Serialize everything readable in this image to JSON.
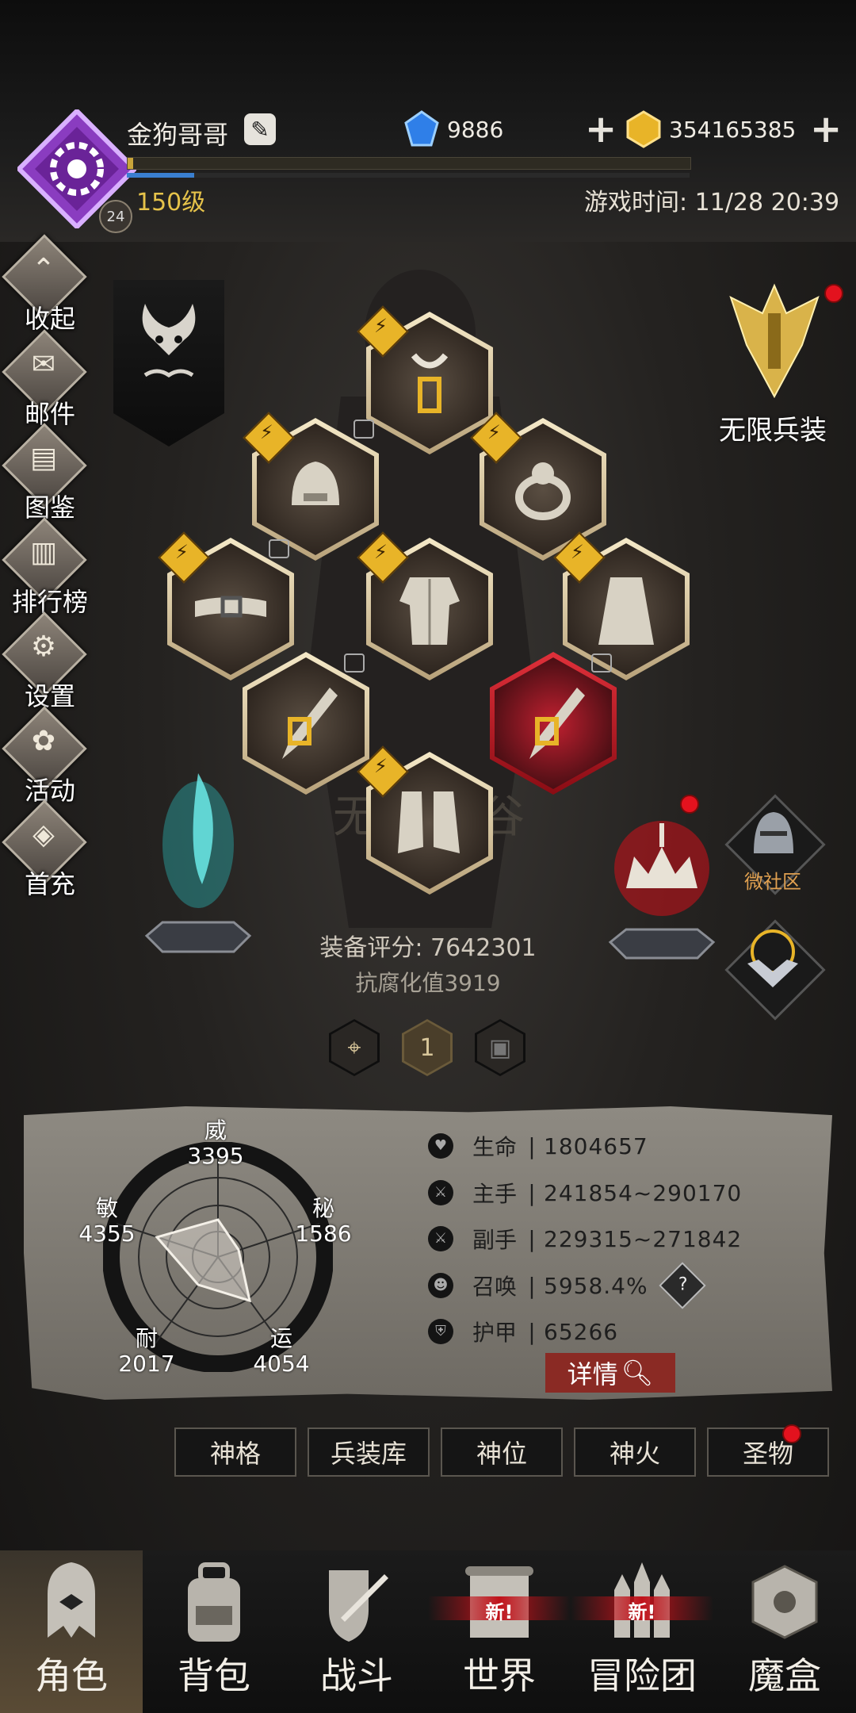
{
  "player": {
    "name": "金狗哥哥",
    "level_text": "150级",
    "avatar_badge": "24",
    "exp_fraction": 0.01,
    "hp_fraction": 0.12
  },
  "currency": {
    "diamond": "9886",
    "gold": "354165385"
  },
  "game_time": "游戏时间: 11/28 20:39",
  "side_menu": [
    {
      "label": "收起",
      "icon": "collapse-icon"
    },
    {
      "label": "邮件",
      "icon": "mail-icon"
    },
    {
      "label": "图鉴",
      "icon": "book-icon"
    },
    {
      "label": "排行榜",
      "icon": "ranking-icon"
    },
    {
      "label": "设置",
      "icon": "gear-icon"
    },
    {
      "label": "活动",
      "icon": "activity-icon"
    },
    {
      "label": "首充",
      "icon": "first-recharge-icon"
    }
  ],
  "right_buttons": {
    "infinite_weapon": "无限兵装",
    "community": "微社区"
  },
  "equipment": {
    "score_text": "装备评分: 7642301",
    "anti_corrupt_text": "抗腐化值3919",
    "page_number": "1",
    "slots": [
      {
        "name": "necklace",
        "icon": "necklace-icon"
      },
      {
        "name": "helmet",
        "icon": "helmet-icon"
      },
      {
        "name": "ring",
        "icon": "ring-icon"
      },
      {
        "name": "belt",
        "icon": "belt-icon"
      },
      {
        "name": "armor",
        "icon": "armor-icon"
      },
      {
        "name": "cape",
        "icon": "cape-icon"
      },
      {
        "name": "main-weapon",
        "icon": "dagger-icon"
      },
      {
        "name": "off-weapon",
        "icon": "dagger-icon"
      },
      {
        "name": "boots",
        "icon": "boots-icon"
      }
    ]
  },
  "radar": {
    "wei": {
      "label": "威",
      "value": "3395"
    },
    "mi": {
      "label": "秘",
      "value": "1586"
    },
    "yun": {
      "label": "运",
      "value": "4054"
    },
    "nai": {
      "label": "耐",
      "value": "2017"
    },
    "min": {
      "label": "敏",
      "value": "4355"
    }
  },
  "stats": [
    {
      "key": "生命",
      "value": "1804657",
      "icon": "heart-icon"
    },
    {
      "key": "主手",
      "value": "241854~290170",
      "icon": "main-hand-icon"
    },
    {
      "key": "副手",
      "value": "229315~271842",
      "icon": "off-hand-icon"
    },
    {
      "key": "召唤",
      "value": "5958.4%",
      "icon": "summon-icon"
    },
    {
      "key": "护甲",
      "value": "65266",
      "icon": "armor-stat-icon"
    }
  ],
  "stat_separator": "|",
  "detail_button": "详情",
  "tabs": [
    "神格",
    "兵装库",
    "神位",
    "神火",
    "圣物"
  ],
  "nav": [
    {
      "label": "角色",
      "icon": "character-icon"
    },
    {
      "label": "背包",
      "icon": "backpack-icon"
    },
    {
      "label": "战斗",
      "icon": "battle-icon"
    },
    {
      "label": "世界",
      "icon": "world-icon",
      "tag": "新!"
    },
    {
      "label": "冒险团",
      "icon": "adventure-team-icon",
      "tag": "新!"
    },
    {
      "label": "魔盒",
      "icon": "magic-box-icon"
    }
  ]
}
